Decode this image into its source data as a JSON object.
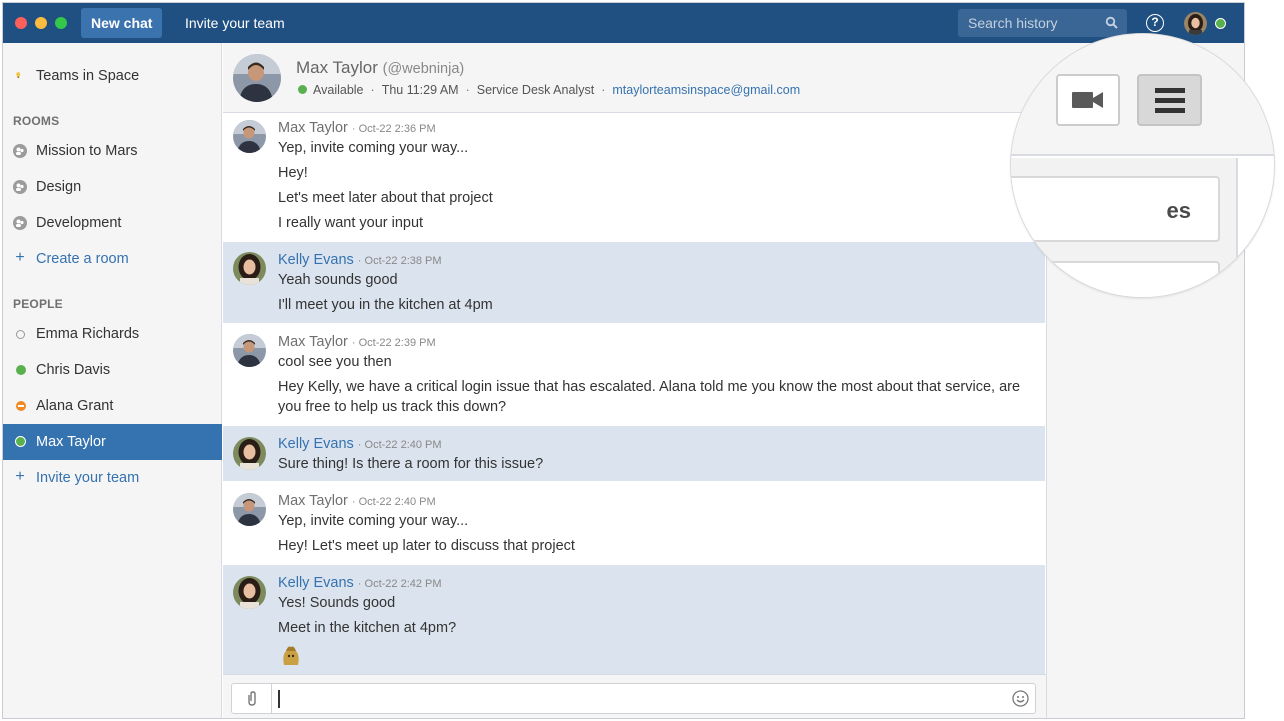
{
  "window": {
    "new_chat_label": "New chat",
    "invite_label": "Invite your team",
    "search_placeholder": "Search history",
    "help_glyph": "?"
  },
  "sidebar": {
    "team": "Teams in Space",
    "rooms_heading": "ROOMS",
    "rooms": [
      "Mission to Mars",
      "Design",
      "Development"
    ],
    "create_room": "Create a room",
    "people_heading": "PEOPLE",
    "people": [
      {
        "name": "Emma Richards",
        "status": "offline"
      },
      {
        "name": "Chris Davis",
        "status": "available"
      },
      {
        "name": "Alana Grant",
        "status": "do-not-disturb"
      },
      {
        "name": "Max Taylor",
        "status": "available",
        "active": true
      }
    ],
    "invite": "Invite your team",
    "plus": "+"
  },
  "header": {
    "name": "Max Taylor",
    "handle": "(@webninja)",
    "status": "Available",
    "time": "Thu 11:29 AM",
    "role": "Service Desk Analyst",
    "email": "mtaylorteamsinspace@gmail.com",
    "sep": "·"
  },
  "messages": [
    {
      "author": "Max Taylor",
      "time": "· Oct-22 2:36 PM",
      "lines": [
        "Yep, invite coming your way...",
        "Hey!",
        "Let's meet later about that project",
        "I really want your input"
      ]
    },
    {
      "author": "Kelly Evans",
      "time": "· Oct-22 2:38 PM",
      "lines": [
        "Yeah sounds good",
        "I'll meet you in the kitchen at 4pm"
      ]
    },
    {
      "author": "Max Taylor",
      "time": "· Oct-22 2:39 PM",
      "lines": [
        "cool see you then",
        "Hey Kelly, we have a critical login issue that has escalated. Alana told me you know the most about that service, are you free to help us track this down?"
      ]
    },
    {
      "author": "Kelly Evans",
      "time": "· Oct-22 2:40 PM",
      "lines": [
        "Sure thing! Is there a room for this issue?"
      ]
    },
    {
      "author": "Max Taylor",
      "time": "· Oct-22 2:40 PM",
      "lines": [
        "Yep, invite coming your way...",
        "Hey! Let's meet up later to discuss that project"
      ]
    },
    {
      "author": "Kelly Evans",
      "time": "· Oct-22 2:42 PM",
      "lines": [
        "Yes! Sounds good",
        "Meet in the kitchen at 4pm?"
      ]
    }
  ],
  "magnifier": {
    "partial_text": "es"
  },
  "colors": {
    "topbar": "#205081",
    "accent": "#3572b0",
    "available": "#59b04e",
    "dnd": "#f08a24",
    "alt_row": "#dbe4ee"
  },
  "icons": [
    "search-icon",
    "help-icon",
    "room-icon",
    "plus-icon",
    "video-icon",
    "menu-icon",
    "attach-icon",
    "emoji-icon",
    "sticker-icon"
  ]
}
